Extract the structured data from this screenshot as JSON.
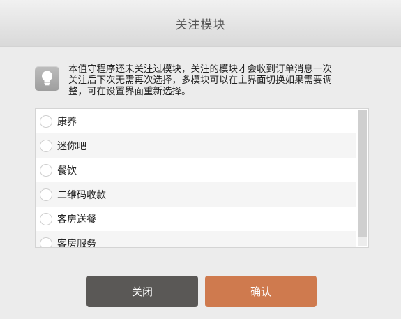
{
  "dialog": {
    "title": "关注模块",
    "notice": {
      "text": "本值守程序还未关注过模块，关注的模块才会收到订单消息一次关注后下次无需再次选择，多模块可以在主界面切换如果需要调整，可在设置界面重新选择。",
      "icon": "lightbulb-icon"
    },
    "modules": [
      {
        "label": "康养"
      },
      {
        "label": "迷你吧"
      },
      {
        "label": "餐饮"
      },
      {
        "label": "二维码收款"
      },
      {
        "label": "客房送餐"
      },
      {
        "label": "客房服务"
      }
    ],
    "buttons": {
      "close_label": "关闭",
      "confirm_label": "确认"
    },
    "colors": {
      "close_button": "#5a5856",
      "confirm_button": "#cf7a4e",
      "header_bg": "#e4e4e4"
    }
  }
}
